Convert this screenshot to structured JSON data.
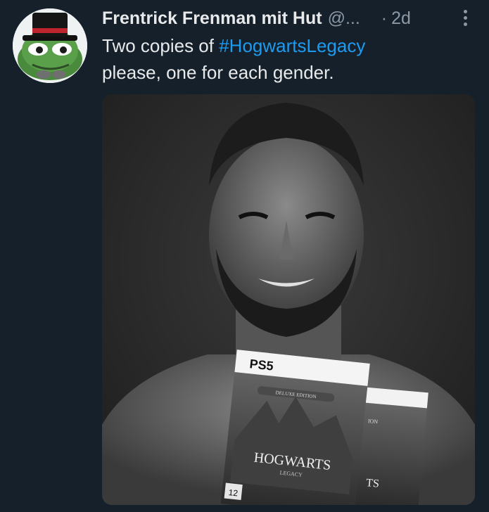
{
  "tweet": {
    "author_name": "Frentrick Frenman mit Hut",
    "handle": "@...",
    "separator": "·",
    "time": "2d",
    "text_before": "Two copies of ",
    "hashtag": "#HogwartsLegacy",
    "text_after": "please, one for each gender."
  },
  "media": {
    "box_brand": "PS5",
    "edition_label": "DELUXE EDITION",
    "game_title": "HOGWARTS",
    "game_subtitle": "LEGACY",
    "age_rating": "12",
    "second_box_edition_fragment": "ION",
    "second_box_title_fragment": "TS"
  },
  "colors": {
    "background": "#15202b",
    "text": "#e7e9ea",
    "secondary": "#8b98a5",
    "link": "#1d9bf0"
  },
  "icons": {
    "more": "more-vertical-icon",
    "playstation": "playstation-logo-icon"
  }
}
